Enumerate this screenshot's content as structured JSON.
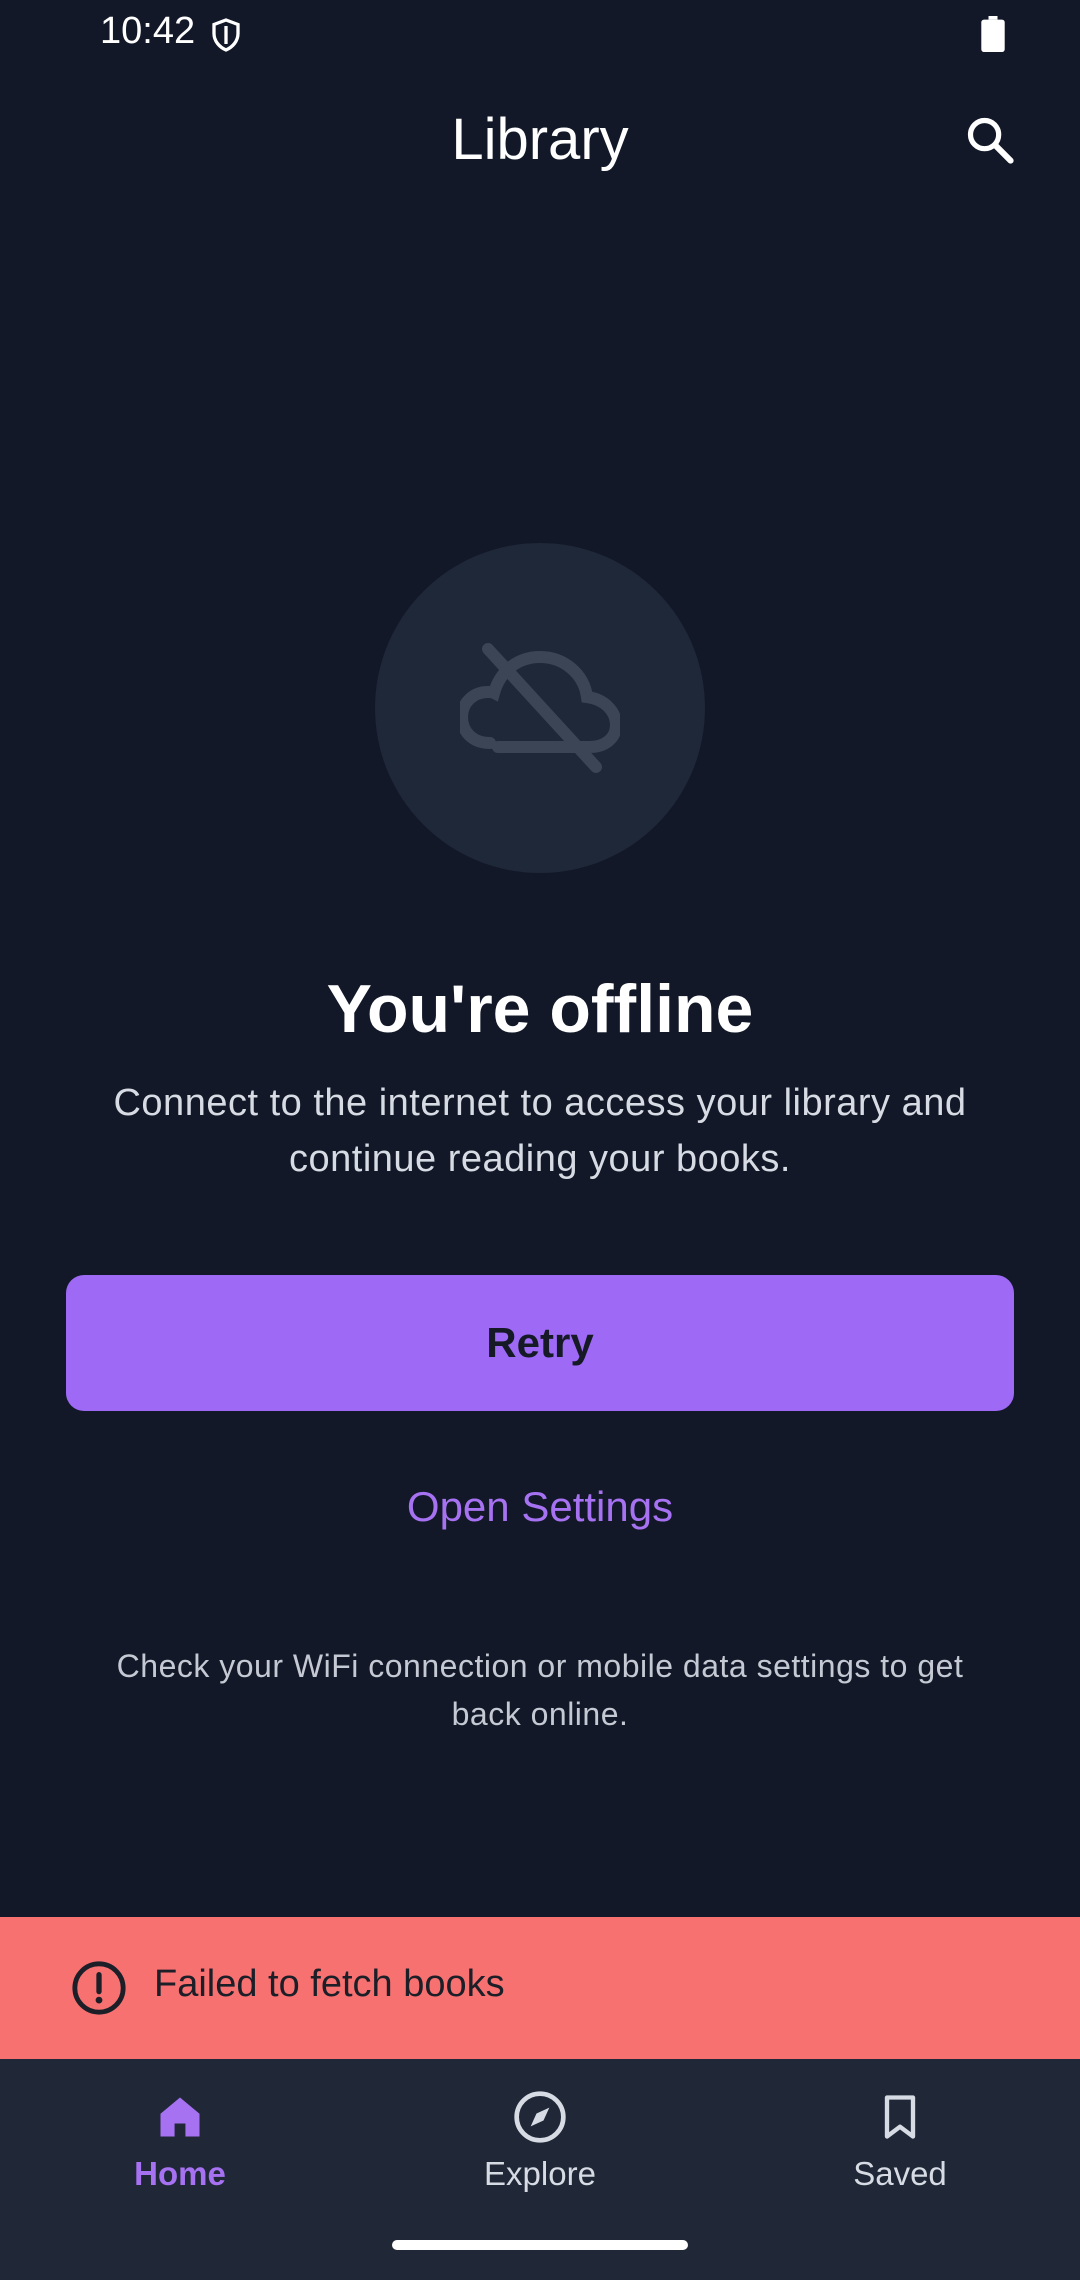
{
  "status_bar": {
    "time": "10:42",
    "icons": [
      "shield-icon",
      "battery-icon"
    ]
  },
  "app_bar": {
    "title": "Library",
    "search_icon": "search-icon"
  },
  "empty_state": {
    "icon": "cloud-off-icon",
    "title": "You're offline",
    "description": "Connect to the internet to access your library and continue reading your books.",
    "retry_label": "Retry",
    "settings_label": "Open Settings",
    "hint": "Check your WiFi connection or mobile data settings to get back online."
  },
  "error_banner": {
    "icon": "error-circle-icon",
    "message": "Failed to fetch books",
    "color": "#f87171"
  },
  "bottom_nav": {
    "items": [
      {
        "label": "Home",
        "icon": "home-icon",
        "active": true
      },
      {
        "label": "Explore",
        "icon": "compass-icon",
        "active": false
      },
      {
        "label": "Saved",
        "icon": "bookmark-icon",
        "active": false
      }
    ]
  },
  "colors": {
    "background": "#121828",
    "accent": "#9d69f5",
    "link": "#a772f2",
    "error": "#f87171"
  }
}
